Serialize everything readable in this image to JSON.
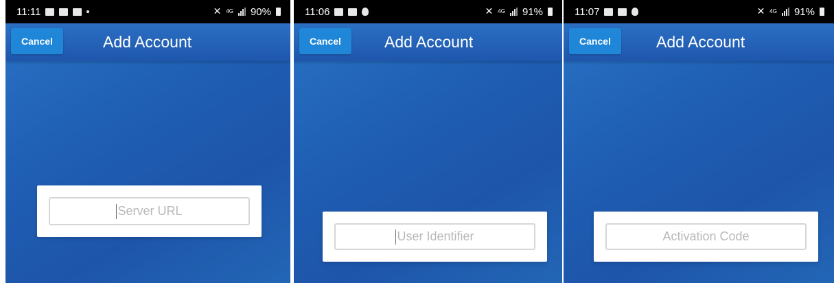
{
  "screens": [
    {
      "status": {
        "time": "11:11",
        "battery": "90%",
        "network": "4G"
      },
      "header": {
        "cancel_label": "Cancel",
        "title": "Add Account"
      },
      "field": {
        "placeholder": "Server URL",
        "focused": true
      }
    },
    {
      "status": {
        "time": "11:06",
        "battery": "91%",
        "network": "4G"
      },
      "header": {
        "cancel_label": "Cancel",
        "title": "Add Account"
      },
      "field": {
        "placeholder": "User Identifier",
        "focused": true
      }
    },
    {
      "status": {
        "time": "11:07",
        "battery": "91%",
        "network": "4G"
      },
      "header": {
        "cancel_label": "Cancel",
        "title": "Add Account"
      },
      "field": {
        "placeholder": "Activation Code",
        "focused": false
      }
    }
  ],
  "colors": {
    "background_accent": "#1f5fb4",
    "cancel_button": "#1f86d8",
    "status_bar": "#000000"
  },
  "icons": [
    "weather-icon",
    "image-icon",
    "mail-icon",
    "dot-icon",
    "user-icon",
    "mute-icon",
    "signal-icon",
    "battery-icon"
  ]
}
